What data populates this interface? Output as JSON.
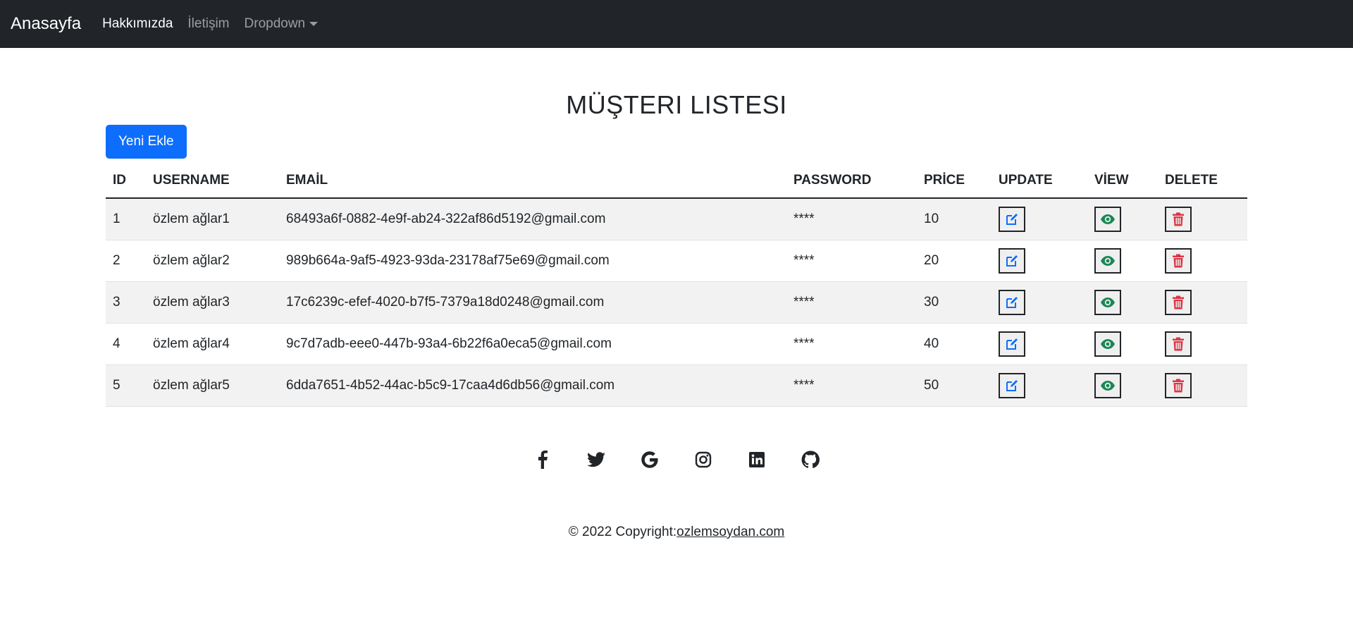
{
  "nav": {
    "brand": "Anasayfa",
    "links": [
      "Hakkımızda",
      "İletişim",
      "Dropdown"
    ]
  },
  "page": {
    "title": "MÜŞTERI LISTESI",
    "add_button": "Yeni Ekle"
  },
  "table": {
    "headers": [
      "ID",
      "USERNAME",
      "EMAİL",
      "PASSWORD",
      "PRİCE",
      "UPDATE",
      "VİEW",
      "DELETE"
    ],
    "rows": [
      {
        "id": "1",
        "username": "özlem ağlar1",
        "email": "68493a6f-0882-4e9f-ab24-322af86d5192@gmail.com",
        "password": "****",
        "price": "10"
      },
      {
        "id": "2",
        "username": "özlem ağlar2",
        "email": "989b664a-9af5-4923-93da-23178af75e69@gmail.com",
        "password": "****",
        "price": "20"
      },
      {
        "id": "3",
        "username": "özlem ağlar3",
        "email": "17c6239c-efef-4020-b7f5-7379a18d0248@gmail.com",
        "password": "****",
        "price": "30"
      },
      {
        "id": "4",
        "username": "özlem ağlar4",
        "email": "9c7d7adb-eee0-447b-93a4-6b22f6a0eca5@gmail.com",
        "password": "****",
        "price": "40"
      },
      {
        "id": "5",
        "username": "özlem ağlar5",
        "email": "6dda7651-4b52-44ac-b5c9-17caa4d6db56@gmail.com",
        "password": "****",
        "price": "50"
      }
    ],
    "action_icons": [
      "edit-icon",
      "eye-icon",
      "trash-icon"
    ]
  },
  "social_icons": [
    "facebook-icon",
    "twitter-icon",
    "google-icon",
    "instagram-icon",
    "linkedin-icon",
    "github-icon"
  ],
  "footer": {
    "copyright": "© 2022 Copyright:",
    "link": "ozlemsoydan.com"
  },
  "colors": {
    "navbar": "#212529",
    "primary": "#0d6efd",
    "edit": "#0d6efd",
    "view": "#198754",
    "delete": "#dc3545"
  }
}
